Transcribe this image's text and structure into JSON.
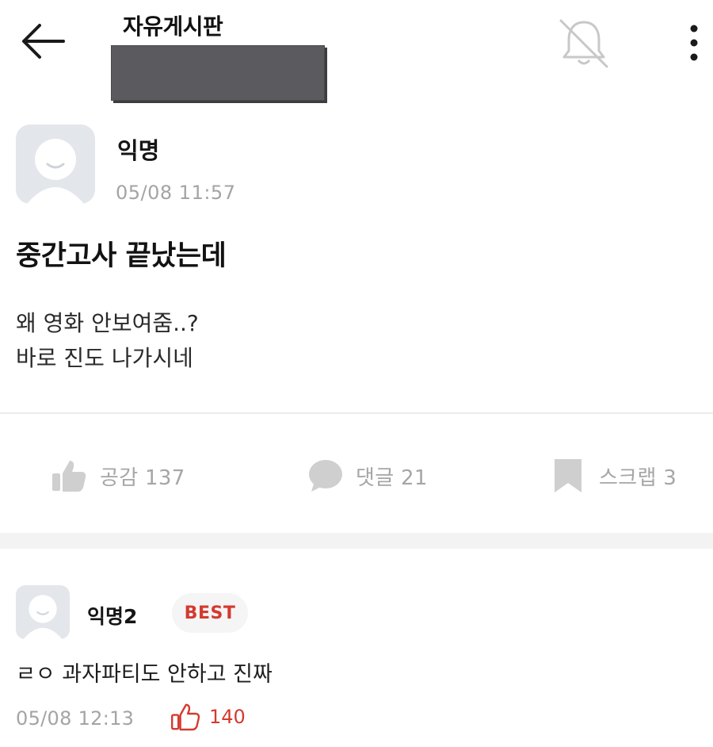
{
  "header": {
    "board_title": "자유게시판",
    "icons": {
      "back": "arrow-left-icon",
      "bell": "bell-off-icon",
      "more": "more-vertical-icon"
    }
  },
  "post": {
    "author": "익명",
    "date": "05/08 11:57",
    "title": "중간고사 끝났는데",
    "body_lines": [
      "왜 영화 안보여줌..?",
      "바로 진도 나가시네"
    ]
  },
  "actions": {
    "like_label": "공감 137",
    "comment_label": "댓글 21",
    "scrap_label": "스크랩 3"
  },
  "comment": {
    "author": "익명2",
    "badge": "BEST",
    "text": "ㄹㅇ 과자파티도 안하고 진짜",
    "date": "05/08 12:13",
    "likes": "140"
  },
  "colors": {
    "accent_red": "#d43a2f",
    "muted_gray": "#a6a6a6",
    "redaction": "#5b5b5f"
  }
}
